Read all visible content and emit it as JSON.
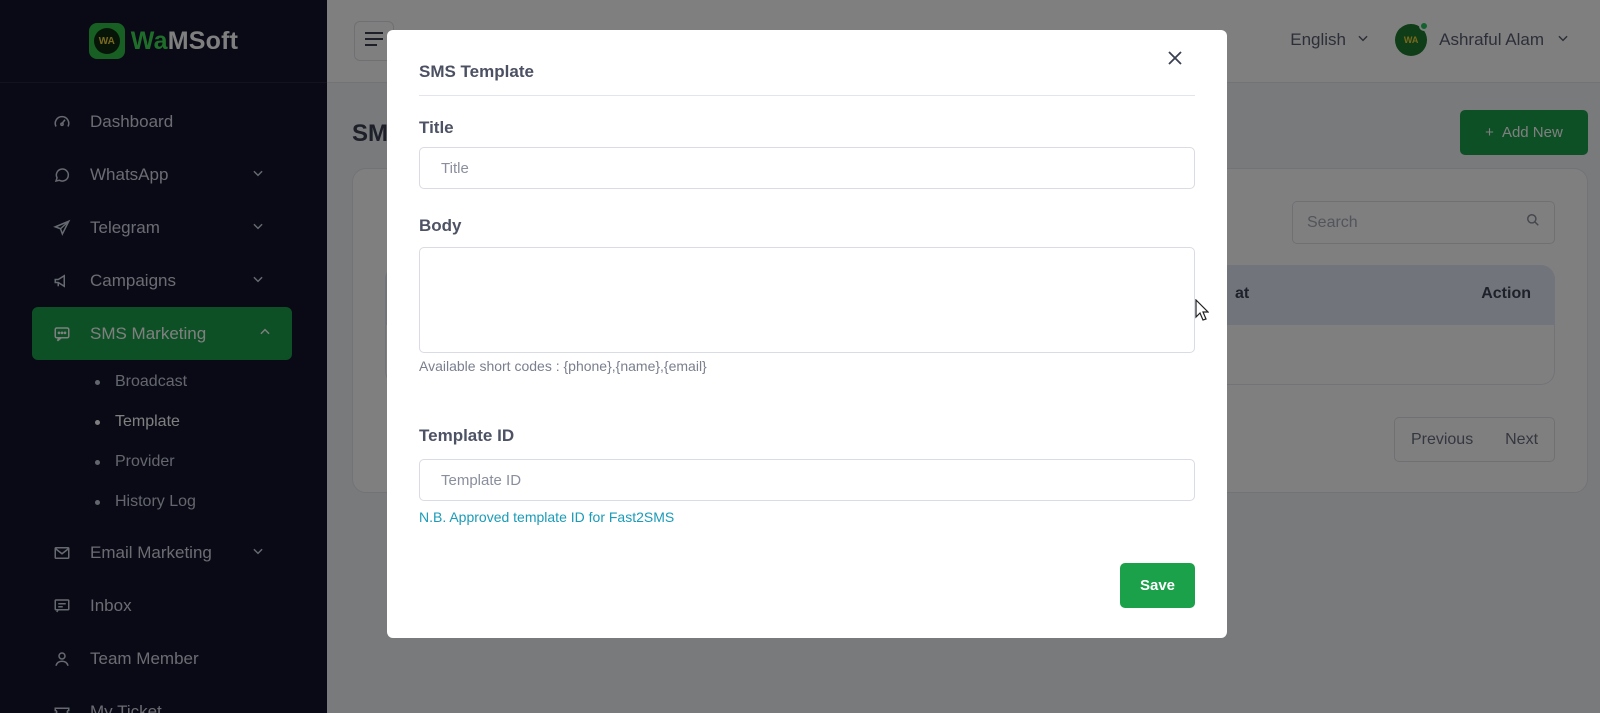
{
  "brand": {
    "prefix": "Wa",
    "suffix": "MSoft",
    "logo_text": "WA"
  },
  "sidebar": {
    "items": [
      {
        "label": "Dashboard",
        "icon": "gauge-icon"
      },
      {
        "label": "WhatsApp",
        "icon": "whatsapp-icon"
      },
      {
        "label": "Telegram",
        "icon": "telegram-icon"
      },
      {
        "label": "Campaigns",
        "icon": "megaphone-icon"
      },
      {
        "label": "SMS Marketing",
        "icon": "chat-icon"
      },
      {
        "label": "Email Marketing",
        "icon": "mail-icon"
      },
      {
        "label": "Inbox",
        "icon": "inbox-icon"
      },
      {
        "label": "Team Member",
        "icon": "user-icon"
      },
      {
        "label": "My Ticket",
        "icon": "ticket-icon"
      }
    ],
    "sms_sub": [
      "Broadcast",
      "Template",
      "Provider",
      "History Log"
    ]
  },
  "header": {
    "language": "English",
    "user_name": "Ashraful Alam"
  },
  "page": {
    "title_visible": "SM",
    "add_button": "Add New",
    "search_placeholder": "Search",
    "col_at": "at",
    "col_action": "Action",
    "prev": "Previous",
    "next": "Next"
  },
  "modal": {
    "title": "SMS Template",
    "title_label": "Title",
    "title_placeholder": "Title",
    "body_label": "Body",
    "body_hint": "Available short codes : {phone},{name},{email}",
    "template_id_label": "Template ID",
    "template_id_placeholder": "Template ID",
    "template_note": "N.B. Approved template ID for Fast2SMS",
    "save_label": "Save"
  },
  "colors": {
    "accent": "#1aa14a",
    "sidebar_bg": "#12152b",
    "note": "#1a9bb8"
  }
}
